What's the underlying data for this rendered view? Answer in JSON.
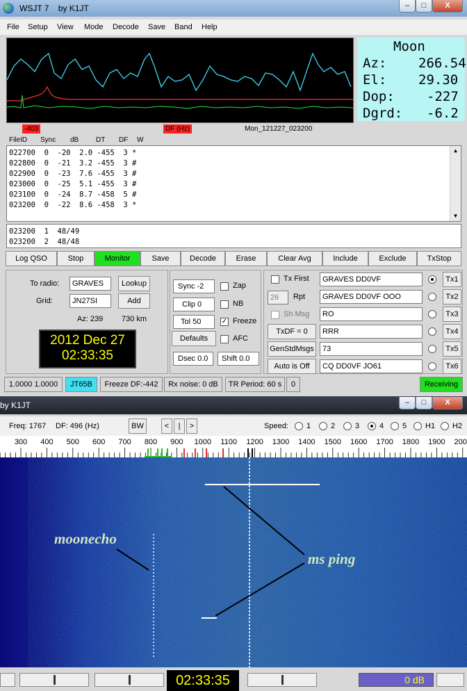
{
  "main_window": {
    "title": "WSJT 7",
    "subtitle": "by K1JT",
    "controls": {
      "minimize": "–",
      "maximize": "□",
      "close": "X"
    }
  },
  "menu": [
    "File",
    "Setup",
    "View",
    "Mode",
    "Decode",
    "Save",
    "Band",
    "Help"
  ],
  "moon": {
    "title": "Moon",
    "az_label": "Az:",
    "az": "266.54",
    "el_label": "El:",
    "el": "29.30",
    "dop_label": "Dop:",
    "dop": "-227",
    "dgrd_label": "Dgrd:",
    "dgrd": "-6.2"
  },
  "plot_axis": {
    "left_value": "-403",
    "center_label": "DF (Hz)",
    "file_label": "Mon_121227_023200"
  },
  "decode_headers": [
    "FileID",
    "Sync",
    "dB",
    "DT",
    "DF",
    "W"
  ],
  "decodes": [
    "022700  0  -20  2.0 -455  3 *",
    "022800  0  -21  3.2 -455  3 #",
    "022900  0  -23  7.6 -455  3 #",
    "023000  0  -25  5.1 -455  3 #",
    "023100  0  -24  8.7 -458  5 #",
    "023200  0  -22  8.6 -458  3 *"
  ],
  "averages": [
    "023200  1  48/49",
    "023200  2  48/48"
  ],
  "buttons": [
    "Log QSO",
    "Stop",
    "Monitor",
    "Save",
    "Decode",
    "Erase",
    "Clear Avg",
    "Include",
    "Exclude",
    "TxStop"
  ],
  "station": {
    "to_radio_label": "To radio:",
    "to_radio": "GRAVES",
    "lookup": "Lookup",
    "grid_label": "Grid:",
    "grid": "JN27SI",
    "add": "Add",
    "az": "Az: 239",
    "distance": "730 km"
  },
  "clock": {
    "date": "2012 Dec 27",
    "time": "02:33:35"
  },
  "decode_controls": {
    "sync": "Sync  -2",
    "clip": "Clip  0",
    "tol": "Tol   50",
    "defaults": "Defaults",
    "dsec": "Dsec  0.0",
    "shift": "Shift 0.0",
    "zap": "Zap",
    "nb": "NB",
    "freeze": "Freeze",
    "afc": "AFC",
    "freeze_checked": true
  },
  "tx": {
    "tx_first": "Tx First",
    "rpt_value": "26",
    "rpt_label": "Rpt",
    "sh_msg": "Sh Msg",
    "txdf": "TxDF = 0",
    "genstd": "GenStdMsgs",
    "auto": "Auto is Off",
    "messages": [
      "GRAVES DD0VF",
      "GRAVES DD0VF OOO",
      "RO",
      "RRR",
      "73",
      "CQ DD0VF JO61"
    ],
    "labels": [
      "Tx1",
      "Tx2",
      "Tx3",
      "Tx4",
      "Tx5",
      "Tx6"
    ],
    "selected": 1
  },
  "status": {
    "levels": "1.0000 1.0000",
    "mode": "JT65B",
    "freeze_df": "Freeze DF:-442",
    "rx_noise": "Rx noise:  0 dB",
    "tr_period": "TR Period: 60 s",
    "count": "0",
    "state": "Receiving"
  },
  "spec_window": {
    "title": "by K1JT",
    "freq": "Freq:  1767",
    "df": "DF:  496  (Hz)",
    "bw": "BW",
    "nav": [
      "<",
      "|",
      ">"
    ],
    "speed_label": "Speed:",
    "speed_options": [
      "1",
      "2",
      "3",
      "4",
      "5",
      "H1",
      "H2"
    ],
    "speed_selected": "4",
    "scale_ticks": [
      "300",
      "400",
      "500",
      "600",
      "700",
      "800",
      "900",
      "1000",
      "1100",
      "1200",
      "1300",
      "1400",
      "1500",
      "1600",
      "1700",
      "1800",
      "1900",
      "2000"
    ],
    "annotations": {
      "moonecho": "moonecho",
      "msping": "ms ping"
    },
    "bottom_time": "02:33:35",
    "level": "0 dB"
  },
  "colors": {
    "title_blue": "#a9c6e4",
    "moon_bg": "#b8f6f6",
    "monitor_green": "#20e020",
    "receiving_green": "#20e020",
    "mode_cyan": "#40e0f0",
    "waterfall_blue": "#1a2a9a",
    "clock_yellow": "#ffff00"
  }
}
